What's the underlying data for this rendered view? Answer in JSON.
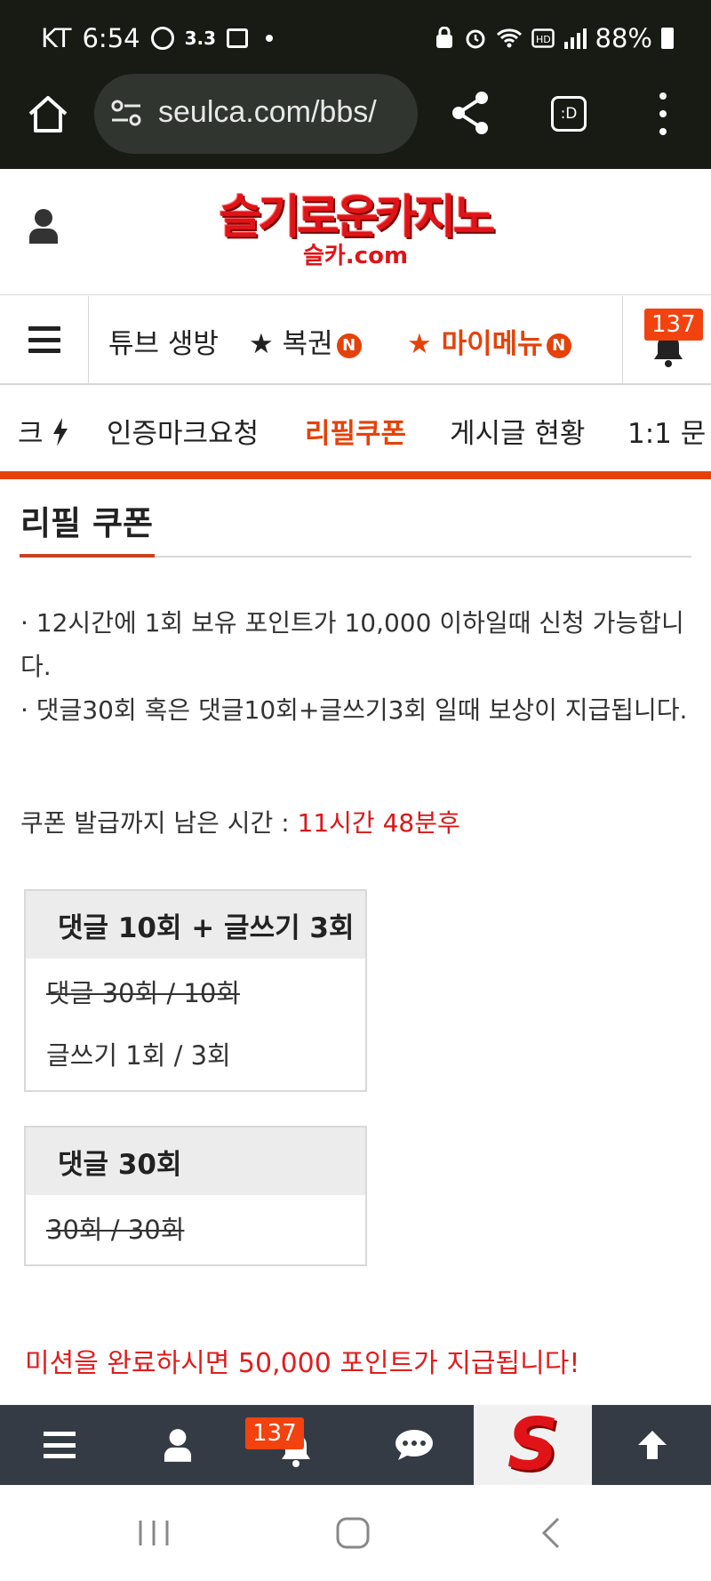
{
  "status_bar": {
    "carrier": "KT",
    "time": "6:54",
    "speed": "3.3",
    "battery": "88%",
    "network_icons": [
      "vpn-icon",
      "alarm-icon",
      "wifi-icon",
      "hd-icon",
      "signal-icon"
    ]
  },
  "browser": {
    "url": "seulca.com/bbs/",
    "tabs_label": ":D"
  },
  "site": {
    "logo_text": "슬기로운카지노",
    "logo_sub": "슬카.com"
  },
  "main_nav": {
    "items": [
      {
        "label": "튜브 생방"
      },
      {
        "label": "★ 복권",
        "badge": "N"
      },
      {
        "label": "★ 마이메뉴",
        "badge": "N"
      }
    ],
    "bell_count": "137"
  },
  "sub_nav": {
    "items": [
      "크",
      "인증마크요청",
      "리필쿠폰",
      "게시글 현황",
      "1:1 문"
    ],
    "active": "리필쿠폰"
  },
  "page": {
    "title": "리필 쿠폰",
    "notice_lines": [
      "· 12시간에 1회 보유 포인트가 10,000 이하일때 신청 가능합니다.",
      "· 댓글30회 혹은 댓글10회+글쓰기3회 일때 보상이 지급됩니다."
    ],
    "remain_label": "쿠폰 발급까지 남은 시간 : ",
    "remain_value": "11시간 48분후",
    "missions": [
      {
        "title": "댓글 10회 + 글쓰기 3회",
        "rows": [
          {
            "text": "댓글 30회 / 10회",
            "done": true
          },
          {
            "text": "글쓰기 1회 / 3회",
            "done": false
          }
        ]
      },
      {
        "title": "댓글 30회",
        "rows": [
          {
            "text": "30회 / 30회",
            "done": true
          }
        ]
      }
    ],
    "complete_message": "미션을 완료하시면 50,000 포인트가 지급됩니다!"
  },
  "bottom_bar": {
    "bell_count": "137",
    "logo_letter": "S"
  },
  "colors": {
    "accent": "#e5420a",
    "logo_red": "#e01418",
    "dark_bar": "#171b14",
    "bottom_bar": "#353b45",
    "remain_red": "#d81818"
  }
}
